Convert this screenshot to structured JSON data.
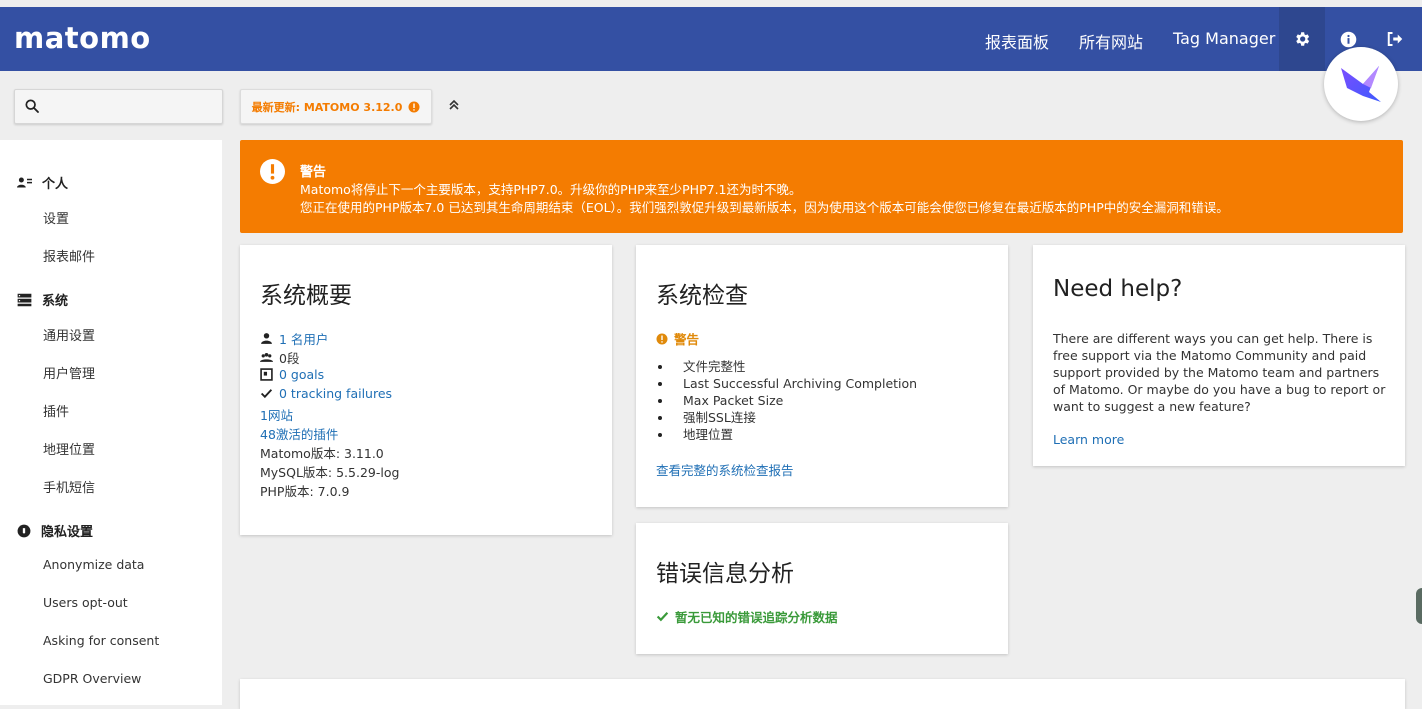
{
  "brand": {
    "logo_text": "matomo",
    "header_color": "#3450a3",
    "accent_orange": "#f47c01"
  },
  "topnav": {
    "links": [
      "报表面板",
      "所有网站",
      "Tag Manager"
    ],
    "icons": [
      "gear-icon",
      "info-icon",
      "logout-icon"
    ]
  },
  "search": {
    "placeholder": ""
  },
  "update": {
    "label": "最新更新: MATOMO 3.12.0"
  },
  "sidebar": {
    "personal": {
      "label": "个人",
      "items": [
        "设置",
        "报表邮件"
      ]
    },
    "system": {
      "label": "系统",
      "items": [
        "通用设置",
        "用户管理",
        "插件",
        "地理位置",
        "手机短信"
      ]
    },
    "privacy": {
      "label": "隐私设置",
      "items": [
        "Anonymize data",
        "Users opt-out",
        "Asking for consent",
        "GDPR Overview"
      ]
    }
  },
  "alert": {
    "title": "警告",
    "line1": "Matomo将停止下一个主要版本，支持PHP7.0。升级你的PHP来至少PHP7.1还为时不晚。",
    "line2": "您正在使用的PHP版本7.0 已达到其生命周期结束（EOL）。我们强烈敦促升级到最新版本，因为使用这个版本可能会使您已修复在最近版本的PHP中的安全漏洞和错误。"
  },
  "summary": {
    "title": "系统概要",
    "users": "1 名用户",
    "segments": "0段",
    "goals": "0 goals",
    "tracking_failures": "0 tracking failures",
    "websites": "1网站",
    "plugins": "48激活的插件",
    "matomo_version": "Matomo版本: 3.11.0",
    "mysql_version": "MySQL版本: 5.5.29-log",
    "php_version": "PHP版本: 7.0.9"
  },
  "syscheck": {
    "title": "系统检查",
    "warning_label": "警告",
    "items": [
      "文件完整性",
      "Last Successful Archiving Completion",
      "Max Packet Size",
      "强制SSL连接",
      "地理位置"
    ],
    "report_link": "查看完整的系统检查报告"
  },
  "help": {
    "title": "Need help?",
    "text": "There are different ways you can get help. There is free support via the Matomo Community and paid support provided by the Matomo team and partners of Matomo. Or maybe do you have a bug to report or want to suggest a new feature?",
    "learn_more": "Learn more"
  },
  "errors": {
    "title": "错误信息分析",
    "status": "暂无已知的错误追踪分析数据"
  }
}
